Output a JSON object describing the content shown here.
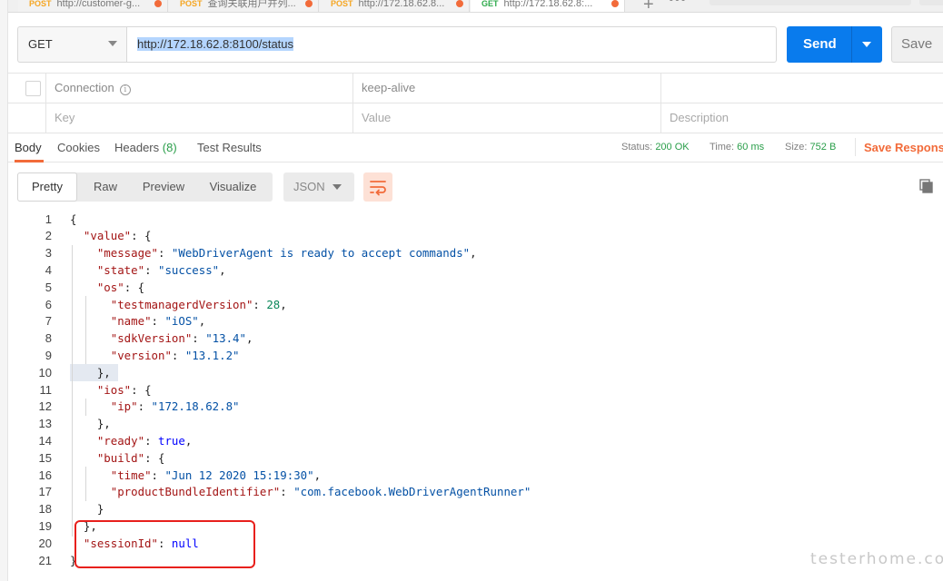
{
  "tabs": [
    {
      "method": "POST",
      "title": "http://customer-g...",
      "active": false
    },
    {
      "method": "POST",
      "title": "查询关联用户并列...",
      "active": false
    },
    {
      "method": "POST",
      "title": "http://172.18.62.8...",
      "active": false
    },
    {
      "method": "GET",
      "title": "http://172.18.62.8:...",
      "active": true
    }
  ],
  "tab_plus": "+",
  "tab_more": "•••",
  "request": {
    "method": "GET",
    "url": "http://172.18.62.8:8100/status",
    "send_label": "Send",
    "save_label": "Save"
  },
  "headers_grid": {
    "row1": {
      "key": "Connection",
      "value": "keep-alive"
    },
    "row2": {
      "key_placeholder": "Key",
      "value_placeholder": "Value",
      "description_placeholder": "Description"
    },
    "info_glyph": "i"
  },
  "response": {
    "tabs": {
      "body": "Body",
      "cookies": "Cookies",
      "headers": "Headers",
      "headers_count": "(8)",
      "test_results": "Test Results"
    },
    "status_label": "Status:",
    "status_value": "200 OK",
    "time_label": "Time:",
    "time_value": "60 ms",
    "size_label": "Size:",
    "size_value": "752 B",
    "save_response": "Save Response"
  },
  "viewer": {
    "modes": [
      "Pretty",
      "Raw",
      "Preview",
      "Visualize"
    ],
    "active_mode": "Pretty",
    "format": "JSON"
  },
  "code_lines": [
    [
      [
        "p",
        "{"
      ]
    ],
    [
      [
        "p",
        "  "
      ],
      [
        "k",
        "\"value\""
      ],
      [
        "p",
        ": {"
      ]
    ],
    [
      [
        "p",
        "    "
      ],
      [
        "k",
        "\"message\""
      ],
      [
        "p",
        ": "
      ],
      [
        "s",
        "\"WebDriverAgent is ready to accept commands\""
      ],
      [
        "p",
        ","
      ]
    ],
    [
      [
        "p",
        "    "
      ],
      [
        "k",
        "\"state\""
      ],
      [
        "p",
        ": "
      ],
      [
        "s",
        "\"success\""
      ],
      [
        "p",
        ","
      ]
    ],
    [
      [
        "p",
        "    "
      ],
      [
        "k",
        "\"os\""
      ],
      [
        "p",
        ": {"
      ]
    ],
    [
      [
        "p",
        "      "
      ],
      [
        "k",
        "\"testmanagerdVersion\""
      ],
      [
        "p",
        ": "
      ],
      [
        "n",
        "28"
      ],
      [
        "p",
        ","
      ]
    ],
    [
      [
        "p",
        "      "
      ],
      [
        "k",
        "\"name\""
      ],
      [
        "p",
        ": "
      ],
      [
        "s",
        "\"iOS\""
      ],
      [
        "p",
        ","
      ]
    ],
    [
      [
        "p",
        "      "
      ],
      [
        "k",
        "\"sdkVersion\""
      ],
      [
        "p",
        ": "
      ],
      [
        "s",
        "\"13.4\""
      ],
      [
        "p",
        ","
      ]
    ],
    [
      [
        "p",
        "      "
      ],
      [
        "k",
        "\"version\""
      ],
      [
        "p",
        ": "
      ],
      [
        "s",
        "\"13.1.2\""
      ]
    ],
    [
      [
        "p",
        "    },"
      ]
    ],
    [
      [
        "p",
        "    "
      ],
      [
        "k",
        "\"ios\""
      ],
      [
        "p",
        ": {"
      ]
    ],
    [
      [
        "p",
        "      "
      ],
      [
        "k",
        "\"ip\""
      ],
      [
        "p",
        ": "
      ],
      [
        "s",
        "\"172.18.62.8\""
      ]
    ],
    [
      [
        "p",
        "    },"
      ]
    ],
    [
      [
        "p",
        "    "
      ],
      [
        "k",
        "\"ready\""
      ],
      [
        "p",
        ": "
      ],
      [
        "b",
        "true"
      ],
      [
        "p",
        ","
      ]
    ],
    [
      [
        "p",
        "    "
      ],
      [
        "k",
        "\"build\""
      ],
      [
        "p",
        ": {"
      ]
    ],
    [
      [
        "p",
        "      "
      ],
      [
        "k",
        "\"time\""
      ],
      [
        "p",
        ": "
      ],
      [
        "s",
        "\"Jun 12 2020 15:19:30\""
      ],
      [
        "p",
        ","
      ]
    ],
    [
      [
        "p",
        "      "
      ],
      [
        "k",
        "\"productBundleIdentifier\""
      ],
      [
        "p",
        ": "
      ],
      [
        "s",
        "\"com.facebook.WebDriverAgentRunner\""
      ]
    ],
    [
      [
        "p",
        "    }"
      ]
    ],
    [
      [
        "p",
        "  },"
      ]
    ],
    [
      [
        "p",
        "  "
      ],
      [
        "k",
        "\"sessionId\""
      ],
      [
        "p",
        ": "
      ],
      [
        "b",
        "null"
      ]
    ],
    [
      [
        "p",
        "}"
      ]
    ]
  ],
  "watermark": "testerhome.com",
  "colors": {
    "send_blue": "#097bed",
    "accent_orange": "#f26b3a",
    "status_green": "#2a9e4a",
    "highlight_red": "#e8201c"
  }
}
